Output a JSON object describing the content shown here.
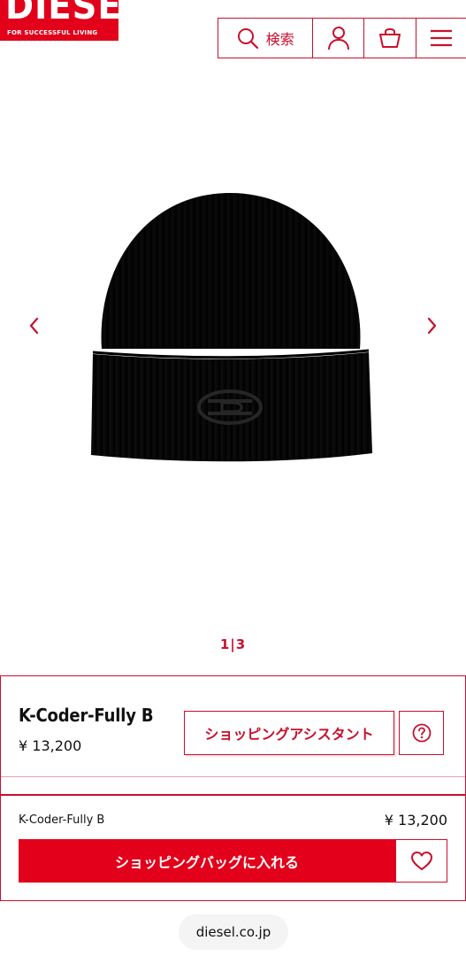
{
  "header": {
    "logo_text": "DIESEL",
    "logo_tagline": "FOR SUCCESSFUL LIVING",
    "search_label": "検索",
    "icons": [
      "search-icon",
      "user-icon",
      "cart-icon",
      "menu-icon"
    ]
  },
  "gallery": {
    "pager": "1|3",
    "prev_icon": "chevron-left-icon",
    "next_icon": "chevron-right-icon"
  },
  "product": {
    "name": "K-Coder-Fully B",
    "price": "¥ 13,200",
    "assistant_label": "ショッピングアシスタント",
    "help_icon": "question-icon"
  },
  "summary": {
    "name": "K-Coder-Fully B",
    "price": "¥ 13,200",
    "add_to_bag_label": "ショッピングバッグに入れる",
    "favorite_icon": "heart-icon"
  },
  "browser": {
    "url": "diesel.co.jp"
  },
  "colors": {
    "brand_red": "#e2001a",
    "outline_red": "#c8102e"
  }
}
